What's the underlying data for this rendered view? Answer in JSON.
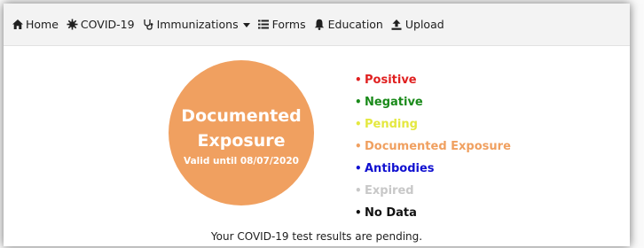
{
  "nav": {
    "items": [
      {
        "label": "Home",
        "icon": "home-icon"
      },
      {
        "label": "COVID-19",
        "icon": "virus-icon"
      },
      {
        "label": "Immunizations",
        "icon": "stethoscope-icon",
        "dropdown": true
      },
      {
        "label": "Forms",
        "icon": "list-icon"
      },
      {
        "label": "Education",
        "icon": "bell-icon"
      },
      {
        "label": "Upload",
        "icon": "upload-icon"
      }
    ]
  },
  "status_circle": {
    "title": "Documented Exposure",
    "subtitle": "Valid until 08/07/2020",
    "color": "#f0a060"
  },
  "legend": [
    {
      "label": "Positive",
      "color": "#e02020"
    },
    {
      "label": "Negative",
      "color": "#1a8a1a"
    },
    {
      "label": "Pending",
      "color": "#e4e840"
    },
    {
      "label": "Documented Exposure",
      "color": "#f0a060"
    },
    {
      "label": "Antibodies",
      "color": "#1010d0"
    },
    {
      "label": "Expired",
      "color": "#c8c8c8"
    },
    {
      "label": "No Data",
      "color": "#111111"
    }
  ],
  "status_message": "Your COVID-19 test results are pending."
}
